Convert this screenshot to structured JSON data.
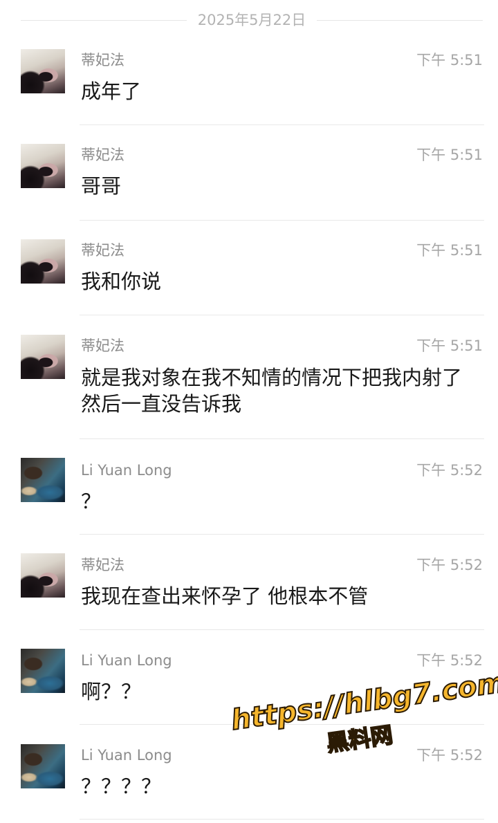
{
  "date_separator": "2025年5月22日",
  "messages": [
    {
      "sender": "蒂妃法",
      "time": "下午 5:51",
      "text": "成年了",
      "avatar": "female-avatar"
    },
    {
      "sender": "蒂妃法",
      "time": "下午 5:51",
      "text": "哥哥",
      "avatar": "female-avatar"
    },
    {
      "sender": "蒂妃法",
      "time": "下午 5:51",
      "text": "我和你说",
      "avatar": "female-avatar"
    },
    {
      "sender": "蒂妃法",
      "time": "下午 5:51",
      "text": "就是我对象在我不知情的情况下把我内射了 然后一直没告诉我",
      "avatar": "female-avatar"
    },
    {
      "sender": "Li Yuan Long",
      "time": "下午 5:52",
      "text": "？",
      "avatar": "male-avatar"
    },
    {
      "sender": "蒂妃法",
      "time": "下午 5:52",
      "text": "我现在查出来怀孕了 他根本不管",
      "avatar": "female-avatar"
    },
    {
      "sender": "Li Yuan Long",
      "time": "下午 5:52",
      "text": "啊？？",
      "avatar": "male-avatar"
    },
    {
      "sender": "Li Yuan Long",
      "time": "下午 5:52",
      "text": "？？？？",
      "avatar": "male-avatar"
    }
  ],
  "watermark": {
    "url": "https://hlbg7.com",
    "label": "黑料网"
  }
}
